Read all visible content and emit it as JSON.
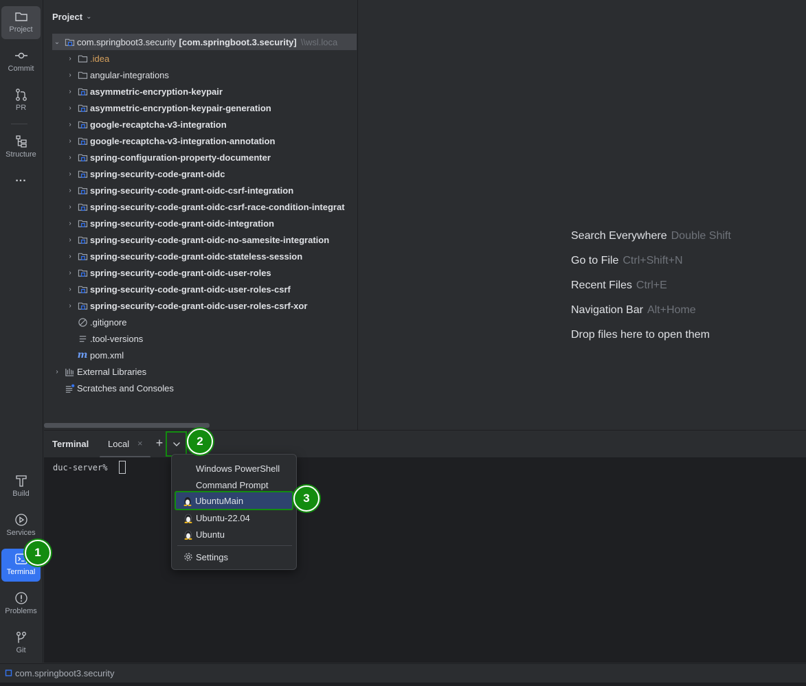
{
  "toolstrip": {
    "top": [
      {
        "label": "Project",
        "icon": "folder-icon"
      },
      {
        "label": "Commit",
        "icon": "commit-icon"
      },
      {
        "label": "PR",
        "icon": "pull-request-icon"
      },
      {
        "label": "Structure",
        "icon": "structure-icon"
      }
    ],
    "more": "...",
    "bottom": [
      {
        "label": "Build",
        "icon": "hammer-icon"
      },
      {
        "label": "Services",
        "icon": "services-icon"
      },
      {
        "label": "Terminal",
        "icon": "terminal-icon"
      },
      {
        "label": "Problems",
        "icon": "problems-icon"
      },
      {
        "label": "Git",
        "icon": "git-icon"
      }
    ]
  },
  "project": {
    "title": "Project",
    "root": {
      "name": "com.springboot3.security",
      "module": "[com.springboot.3.security]",
      "path": "\\\\wsl.loca"
    },
    "children": [
      {
        "name": ".idea",
        "type": "folder"
      },
      {
        "name": "angular-integrations",
        "type": "folder"
      },
      {
        "name": "asymmetric-encryption-keypair",
        "type": "module"
      },
      {
        "name": "asymmetric-encryption-keypair-generation",
        "type": "module"
      },
      {
        "name": "google-recaptcha-v3-integration",
        "type": "module"
      },
      {
        "name": "google-recaptcha-v3-integration-annotation",
        "type": "module"
      },
      {
        "name": "spring-configuration-property-documenter",
        "type": "module"
      },
      {
        "name": "spring-security-code-grant-oidc",
        "type": "module"
      },
      {
        "name": "spring-security-code-grant-oidc-csrf-integration",
        "type": "module"
      },
      {
        "name": "spring-security-code-grant-oidc-csrf-race-condition-integrat",
        "type": "module"
      },
      {
        "name": "spring-security-code-grant-oidc-integration",
        "type": "module"
      },
      {
        "name": "spring-security-code-grant-oidc-no-samesite-integration",
        "type": "module"
      },
      {
        "name": "spring-security-code-grant-oidc-stateless-session",
        "type": "module"
      },
      {
        "name": "spring-security-code-grant-oidc-user-roles",
        "type": "module"
      },
      {
        "name": "spring-security-code-grant-oidc-user-roles-csrf",
        "type": "module"
      },
      {
        "name": "spring-security-code-grant-oidc-user-roles-csrf-xor",
        "type": "module"
      },
      {
        "name": ".gitignore",
        "type": "gitignore"
      },
      {
        "name": ".tool-versions",
        "type": "text"
      },
      {
        "name": "pom.xml",
        "type": "maven"
      }
    ],
    "external_libraries": "External Libraries",
    "scratches": "Scratches and Consoles"
  },
  "editor_hints": [
    {
      "action": "Search Everywhere",
      "shortcut": "Double Shift"
    },
    {
      "action": "Go to File",
      "shortcut": "Ctrl+Shift+N"
    },
    {
      "action": "Recent Files",
      "shortcut": "Ctrl+E"
    },
    {
      "action": "Navigation Bar",
      "shortcut": "Alt+Home"
    },
    {
      "action": "Drop files here to open them",
      "shortcut": ""
    }
  ],
  "terminal": {
    "title": "Terminal",
    "tab": "Local",
    "close": "×",
    "add": "+",
    "prompt": "duc-server%"
  },
  "dropdown": {
    "items": [
      {
        "label": "Windows PowerShell",
        "icon": ""
      },
      {
        "label": "Command Prompt",
        "icon": ""
      },
      {
        "label": "UbuntuMain",
        "icon": "linux-icon",
        "selected": true
      },
      {
        "label": "Ubuntu-22.04",
        "icon": "linux-icon"
      },
      {
        "label": "Ubuntu",
        "icon": "linux-icon"
      }
    ],
    "settings": "Settings"
  },
  "badges": [
    "1",
    "2",
    "3"
  ],
  "status": {
    "project": "com.springboot3.security"
  },
  "colors": {
    "accent": "#3574f0",
    "highlight": "#138c0f"
  }
}
